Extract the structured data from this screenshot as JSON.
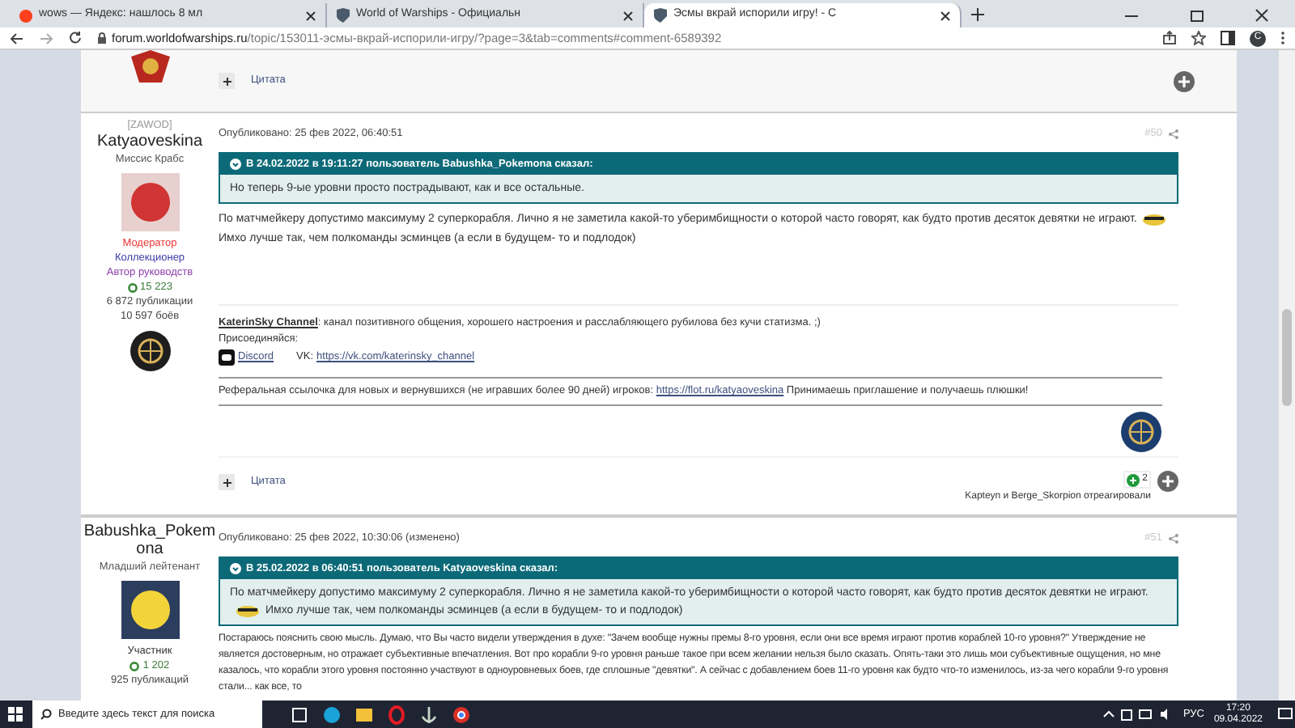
{
  "browser": {
    "tabs": [
      {
        "title": "wows — Яндекс: нашлось 8 мл",
        "selected": false,
        "kind": "yandex"
      },
      {
        "title": "World of Warships - Официальн",
        "selected": false,
        "kind": "shield"
      },
      {
        "title": "Эсмы вкрай испорили игру! - С",
        "selected": true,
        "kind": "shield"
      }
    ],
    "url_host": "forum.worldofwarships.ru",
    "url_path": "/topic/153011-эсмы-вкрай-испорили-игру/?page=3&tab=comments#comment-6589392",
    "profile_initial": "C"
  },
  "posts": [
    {
      "kind": "tail",
      "quote_button": "Цитата"
    },
    {
      "kind": "full",
      "clan": "[ZAWOD]",
      "author": "Katyaoveskina",
      "author_title": "Миссис Крабс",
      "roles": [
        {
          "label": "Модератор",
          "color": "#ee3333"
        },
        {
          "label": "Коллекционер",
          "color": "#3a3aa8"
        },
        {
          "label": "Автор руководств",
          "color": "#8a3aa8"
        }
      ],
      "reputation": "15 223",
      "publications": "6 872 публикации",
      "battles": "10 597 боёв",
      "published": "Опубликовано: 25 фев 2022, 06:40:51",
      "number": "#50",
      "quote": {
        "header": "В 24.02.2022 в 19:11:27 пользователь Babushka_Pokemona сказал:",
        "text": "Но теперь 9-ые уровни просто пострадывают, как и все остальные."
      },
      "body": [
        "По матчмейкеру допустимо максимуму 2 суперкорабля. Лично я не заметила какой-то уберимбищности о которой часто говорят, как будто против десяток девятки не играют.",
        "Имхо лучше так, чем полкоманды эсминцев (а если в будущем- то и подлодок)"
      ],
      "signature": {
        "channel": "KaterinSky Channel",
        "channel_text": ": канал позитивного общения, хорошего настроения и расслабляющего рубилова без кучи статизма. ;)",
        "join": "Присоединяйся:",
        "discord": "Discord",
        "vk_label": "VK:",
        "vk_link": "https://vk.com/katerinsky_channel",
        "referral": "Реферальная ссылочка для новых и вернувшихся (не игравших более 90 дней) игроков:",
        "referral_link": "https://flot.ru/katyaoveskina",
        "referral_tail": "Принимаешь приглашение и получаешь плюшки!"
      },
      "quote_button": "Цитата",
      "reaction_count": "2",
      "reacted": "Kapteyn и Berge_Skorpion отреагировали"
    },
    {
      "kind": "full",
      "author": "Babushka_Pokemona",
      "author_title": "Младший лейтенант",
      "roles": [
        {
          "label": "Участник",
          "color": "#333333"
        }
      ],
      "reputation": "1 202",
      "publications": "925 публикаций",
      "published": "Опубликовано: 25 фев 2022, 10:30:06 (изменено)",
      "number": "#51",
      "quote": {
        "header": "В 25.02.2022 в 06:40:51 пользователь Katyaoveskina сказал:",
        "text": "По матчмейкеру допустимо максимуму 2 суперкорабля. Лично я не заметила какой-то уберимбищности о которой часто говорят, как будто против десяток девятки не играют.",
        "text_after": "Имхо лучше так, чем полкоманды эсминцев (а если в будущем- то и подлодок)"
      },
      "body": [
        "Постараюсь пояснить свою мысль. Думаю, что Вы часто видели утверждения в духе: \"Зачем вообще нужны премы 8-го уровня, если они все время играют против кораблей 10-го уровня?\" Утверждение не является достоверным, но отражает субъективные впечатления. Вот про корабли 9-го уровня раньше такое при всем желании нельзя было сказать. Опять-таки это лишь мои субъективные ощущения, но мне казалось, что корабли этого уровня постоянно участвуют в одноуровневых боев, где сплошные \"девятки\". А сейчас с добавлением боев 11-го уровня как будто что-то изменилось, из-за чего корабли 9-го уровня стали... как все, то"
      ]
    }
  ],
  "taskbar": {
    "search_placeholder": "Введите здесь текст для поиска",
    "language": "РУС",
    "time": "17:20",
    "date": "09.04.2022"
  }
}
